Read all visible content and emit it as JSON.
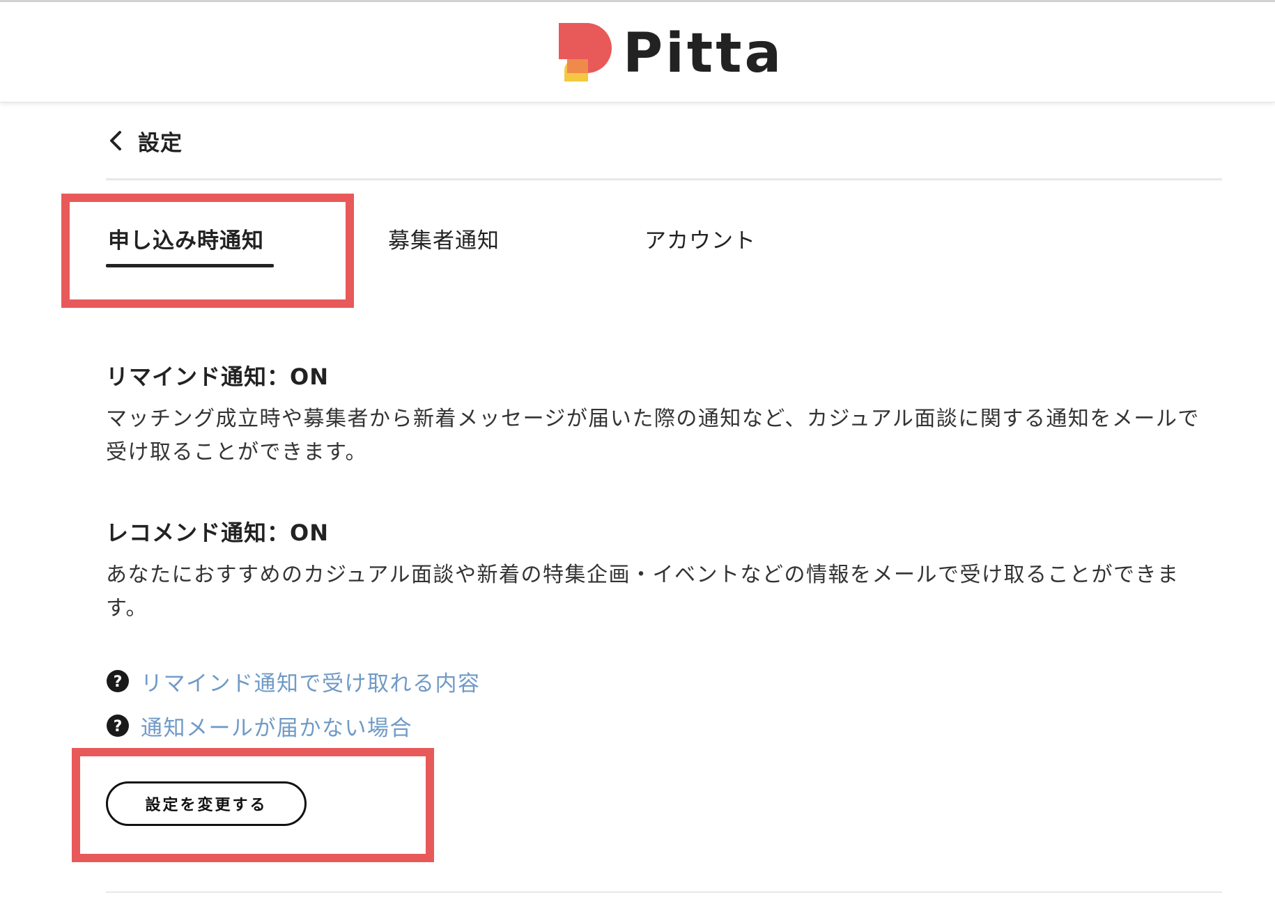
{
  "header": {
    "logo_text": "Pitta",
    "brand_colors": {
      "coral": "#e8595a",
      "yellow": "#f5c842",
      "orange": "#f08a4b"
    }
  },
  "nav": {
    "back_icon": "chevron-left-icon",
    "back_label": "設定"
  },
  "tabs": [
    {
      "label": "申し込み時通知",
      "active": true
    },
    {
      "label": "募集者通知",
      "active": false
    },
    {
      "label": "アカウント",
      "active": false
    }
  ],
  "sections": [
    {
      "title": "リマインド通知：ON",
      "body": "マッチング成立時や募集者から新着メッセージが届いた際の通知など、カジュアル面談に関する通知をメールで受け取ることができます。"
    },
    {
      "title": "レコメンド通知：ON",
      "body": "あなたにおすすめのカジュアル面談や新着の特集企画・イベントなどの情報をメールで受け取ることができます。"
    }
  ],
  "help_links": [
    {
      "icon": "question-circle-icon",
      "label": "リマインド通知で受け取れる内容"
    },
    {
      "icon": "question-circle-icon",
      "label": "通知メールが届かない場合"
    }
  ],
  "actions": {
    "change_settings_label": "設定を変更する"
  },
  "colors": {
    "highlight": "#e8595a",
    "link": "#6f9ac6",
    "text": "#222222"
  }
}
